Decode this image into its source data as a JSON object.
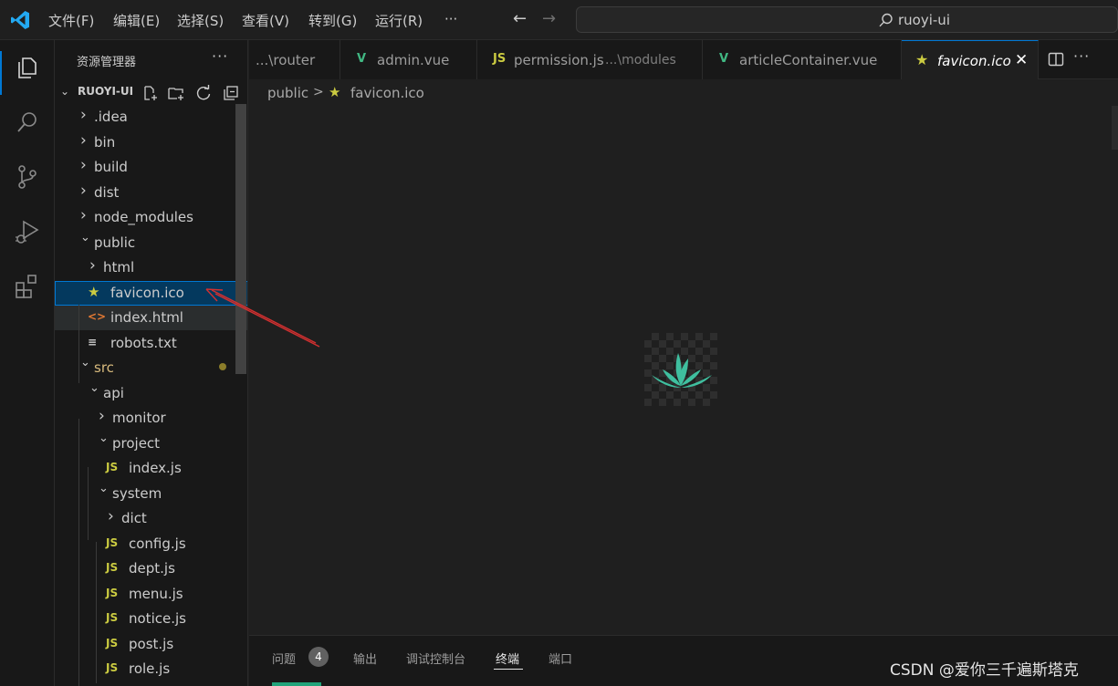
{
  "titlebar": {
    "menu": [
      "文件(F)",
      "编辑(E)",
      "选择(S)",
      "查看(V)",
      "转到(G)",
      "运行(R)"
    ],
    "more": "···",
    "search_text": "ruoyi-ui"
  },
  "activity_bar": {
    "items": [
      "files-icon",
      "search-icon",
      "source-control-icon",
      "run-debug-icon",
      "extensions-icon"
    ],
    "active": "files-icon",
    "accent": "#0078d4"
  },
  "sidebar": {
    "title": "资源管理器",
    "more": "···",
    "project": "RUOYI-UI",
    "tree": [
      {
        "label": ".idea",
        "kind": "folder",
        "open": false
      },
      {
        "label": "bin",
        "kind": "folder",
        "open": false
      },
      {
        "label": "build",
        "kind": "folder",
        "open": false
      },
      {
        "label": "dist",
        "kind": "folder",
        "open": false
      },
      {
        "label": "node_modules",
        "kind": "folder",
        "open": false
      },
      {
        "label": "public",
        "kind": "folder",
        "open": true
      },
      {
        "label": "html",
        "kind": "folder",
        "open": false
      },
      {
        "label": "favicon.ico",
        "kind": "ico",
        "selected": true
      },
      {
        "label": "index.html",
        "kind": "html"
      },
      {
        "label": "robots.txt",
        "kind": "txt"
      },
      {
        "label": "src",
        "kind": "folder",
        "open": true,
        "modified": true
      },
      {
        "label": "api",
        "kind": "folder",
        "open": true
      },
      {
        "label": "monitor",
        "kind": "folder",
        "open": false
      },
      {
        "label": "project",
        "kind": "folder",
        "open": true
      },
      {
        "label": "index.js",
        "kind": "js"
      },
      {
        "label": "system",
        "kind": "folder",
        "open": true
      },
      {
        "label": "dict",
        "kind": "folder",
        "open": false
      },
      {
        "label": "config.js",
        "kind": "js"
      },
      {
        "label": "dept.js",
        "kind": "js"
      },
      {
        "label": "menu.js",
        "kind": "js"
      },
      {
        "label": "notice.js",
        "kind": "js"
      },
      {
        "label": "post.js",
        "kind": "js"
      },
      {
        "label": "role.js",
        "kind": "js"
      }
    ]
  },
  "tabs": [
    {
      "label": "...\\router",
      "icon": "",
      "desc": ""
    },
    {
      "label": "admin.vue",
      "icon": "vue",
      "desc": ""
    },
    {
      "label": "permission.js",
      "icon": "js",
      "desc": "...\\modules"
    },
    {
      "label": "articleContainer.vue",
      "icon": "vue",
      "desc": ""
    },
    {
      "label": "favicon.ico",
      "icon": "ico",
      "desc": "",
      "active": true
    }
  ],
  "icon_glyphs": {
    "vue": "V",
    "js": "JS",
    "ico": "★",
    "html": "<>",
    "txt": "≡"
  },
  "breadcrumb": {
    "folder": "public",
    "sep": ">",
    "file": "favicon.ico"
  },
  "panel": {
    "tabs": [
      "问题",
      "输出",
      "调试控制台",
      "终端",
      "端口"
    ],
    "active": "终端",
    "problems_count": "4"
  },
  "watermark": "CSDN @爱你三千遍斯塔克",
  "colors": {
    "js": "#cbcb41",
    "vue": "#41b883",
    "html": "#e37933",
    "ico": "#cbcb41",
    "selection": "#04395e",
    "logo": "#23a9f2"
  }
}
